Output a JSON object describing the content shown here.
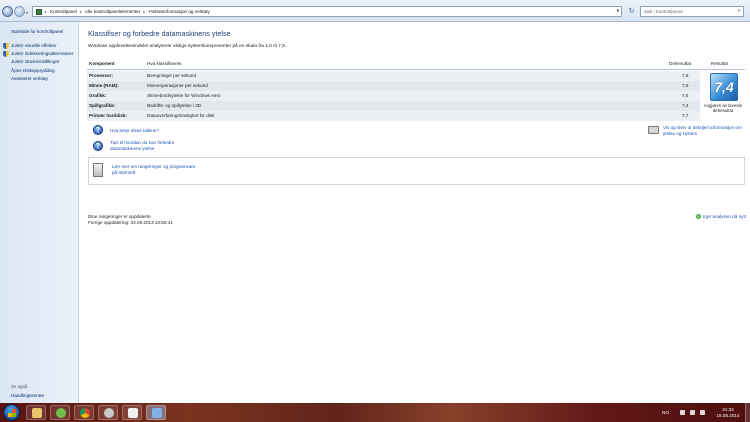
{
  "address_bar": {
    "crumbs": [
      "Kontrollpanel",
      "Alle kontrollpanelelementer",
      "Ytelsesinformasjon og verktøy"
    ],
    "search_placeholder": "Søk i Kontrollpanel"
  },
  "sidebar": {
    "home_link": "Startside for kontrollpanel",
    "tasks": [
      "Juster visuelle effekter",
      "Juster indekseringsalternativer",
      "Juster strøminnstillinger",
      "Åpne Diskopprydding",
      "Avanserte verktøy"
    ],
    "see_also_label": "Se også",
    "see_also_items": [
      "Handlingssenter"
    ]
  },
  "main": {
    "title": "Klassifiser og forbedre datamaskinens ytelse",
    "subtitle": "Windows opplevelsesindeks analyserer viktige systemkomponenter på en skala fra 1,0 til 7,9.",
    "table": {
      "headers": {
        "component": "Komponent",
        "rated": "Hva klassifiseres",
        "subscore": "Delresultat",
        "result": "Resultat"
      },
      "rows": [
        {
          "component": "Prosessor:",
          "description": "Beregninger per sekund",
          "score": "7,6"
        },
        {
          "component": "Minne (RAM):",
          "description": "Minneoperasjoner per sekund",
          "score": "7,6"
        },
        {
          "component": "Grafikk:",
          "description": "Skrivebordsytelse for Windows Aero",
          "score": "7,6"
        },
        {
          "component": "Spillgrafikk:",
          "description": "Bedrifts- og spillytelse i 3D",
          "score": "7,4"
        },
        {
          "component": "Primær harddisk:",
          "description": "Dataoverføringshastighet for disk",
          "score": "7,7"
        }
      ],
      "base_score": "7,4",
      "base_score_caption": "Avgjøres av laveste delresultat"
    },
    "links": {
      "what_mean": "Hva betyr disse tallene?",
      "tips_line1": "Tips til hvordan du kan forbedre",
      "tips_line2": "datamaskinens ytelse",
      "print_line1": "Vis og skriv ut detaljert informasjon om",
      "print_line2": "ytelse og system"
    },
    "info_box": {
      "line1": "Lær mer om rangeringer og programvare",
      "line2": "på Internett"
    },
    "status": {
      "line1": "Dine rangeringer er oppdaterte",
      "line2": "Forrige oppdatering: 02.09.2013 10:59:41"
    },
    "rerun_label": "Kjør analysen på nytt"
  },
  "taskbar": {
    "language": "NO",
    "time": "21:32",
    "date": "15.05.2014"
  }
}
